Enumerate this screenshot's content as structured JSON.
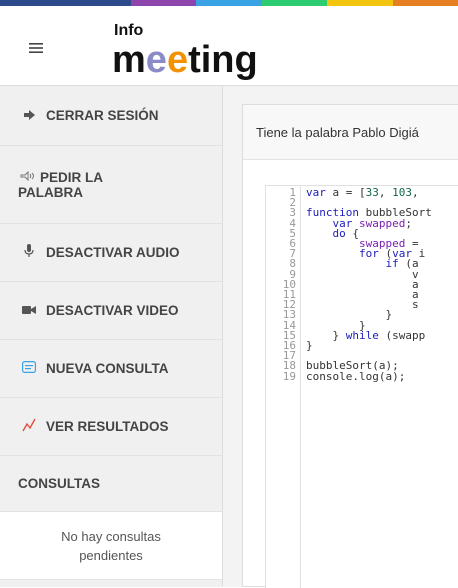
{
  "colors": {
    "topbar_stripes": [
      "#2d4a8a",
      "#8e44ad",
      "#3aa3e3",
      "#2ecc71",
      "#f1c40f",
      "#e67e22",
      "#c0392b"
    ],
    "sidebar_bg": "#f0f0f0",
    "accent_red": "#e74c3c",
    "accent_blue": "#3aa3e3"
  },
  "header": {
    "menu_icon": "hamburger-icon",
    "logo": {
      "small": "Info",
      "big_part1": "m",
      "big_e1": "e",
      "big_e2": "e",
      "big_part2": "ting"
    }
  },
  "sidebar": {
    "items": [
      {
        "label": "CERRAR SESIÓN",
        "icon": "sign-out-icon"
      },
      {
        "label_line1": "PEDIR LA",
        "label_line2": "PALABRA",
        "icon": "hand-icon"
      },
      {
        "label": "DESACTIVAR AUDIO",
        "icon": "microphone-icon"
      },
      {
        "label": "DESACTIVAR VIDEO",
        "icon": "video-camera-icon"
      },
      {
        "label": "NUEVA CONSULTA",
        "icon": "poll-icon"
      },
      {
        "label": "VER RESULTADOS",
        "icon": "chart-line-icon"
      }
    ],
    "consultas_title": "CONSULTAS",
    "consultas_empty": "No hay consultas pendientes"
  },
  "main": {
    "panel_title": "Tiene la palabra Pablo Digiá",
    "code": [
      {
        "n": "1",
        "t": "var a = [33, 103, "
      },
      {
        "n": "2",
        "t": ""
      },
      {
        "n": "3",
        "t": "function bubbleSort"
      },
      {
        "n": "4",
        "t": "    var swapped;"
      },
      {
        "n": "5",
        "t": "    do {"
      },
      {
        "n": "6",
        "t": "        swapped = "
      },
      {
        "n": "7",
        "t": "        for (var i"
      },
      {
        "n": "8",
        "t": "            if (a"
      },
      {
        "n": "9",
        "t": "                v"
      },
      {
        "n": "10",
        "t": "                a"
      },
      {
        "n": "11",
        "t": "                a"
      },
      {
        "n": "12",
        "t": "                s"
      },
      {
        "n": "13",
        "t": "            }"
      },
      {
        "n": "14",
        "t": "        }"
      },
      {
        "n": "15",
        "t": "    } while (swapp"
      },
      {
        "n": "16",
        "t": "}"
      },
      {
        "n": "17",
        "t": ""
      },
      {
        "n": "18",
        "t": "bubbleSort(a);"
      },
      {
        "n": "19",
        "t": "console.log(a);"
      }
    ]
  }
}
